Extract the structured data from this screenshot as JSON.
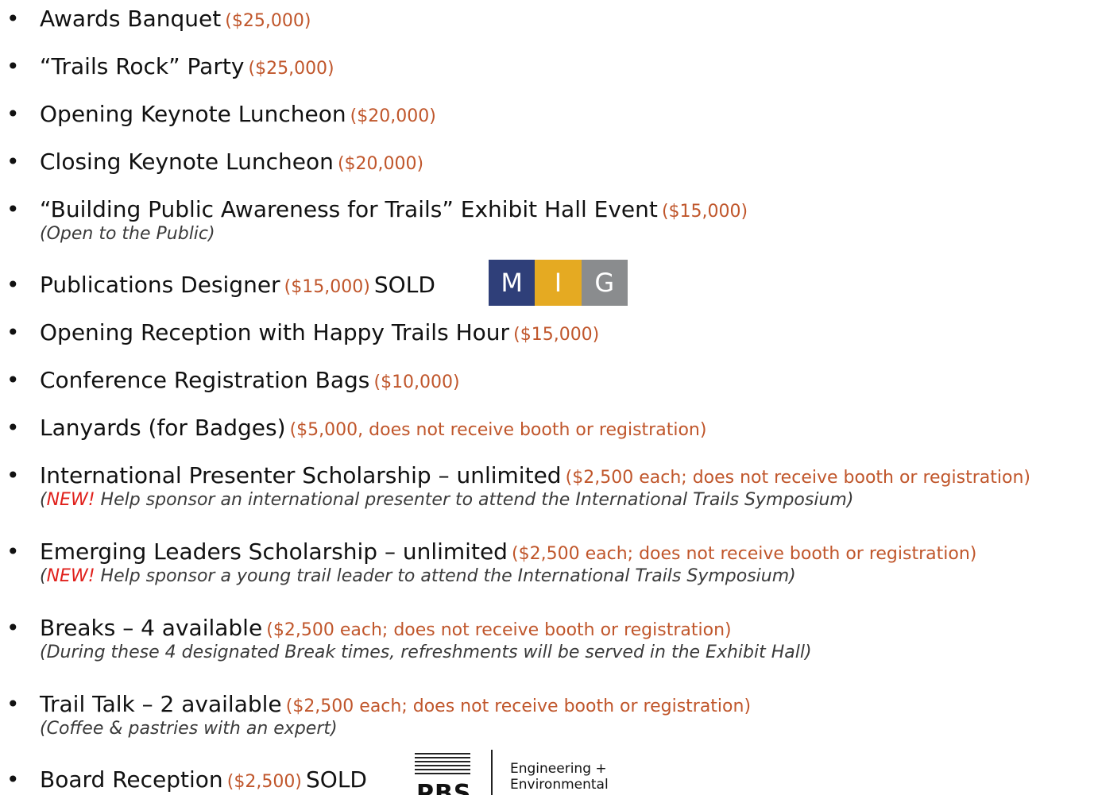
{
  "bullet_char": "•",
  "items": [
    {
      "label": "Awards Banquet",
      "price": "($25,000)"
    },
    {
      "label": "“Trails Rock” Party",
      "price": "($25,000)"
    },
    {
      "label": "Opening Keynote Luncheon",
      "price": "($20,000)"
    },
    {
      "label": "Closing Keynote Luncheon",
      "price": "($20,000)"
    },
    {
      "label": "“Building Public Awareness for Trails” Exhibit Hall Event",
      "price": "($15,000)",
      "note": "(Open to the Public)"
    },
    {
      "label": "Publications Designer",
      "price": "($15,000)",
      "sold": "SOLD"
    },
    {
      "label": "Opening Reception with Happy Trails Hour",
      "price": "($15,000)"
    },
    {
      "label": "Conference Registration Bags",
      "price": "($10,000)"
    },
    {
      "label": "Lanyards (for Badges)",
      "price": "($5,000, does not receive booth or registration)"
    },
    {
      "label": "International Presenter Scholarship – unlimited",
      "price": "($2,500 each; does not receive booth or registration)",
      "note_open": "(",
      "note_new": "NEW!",
      "note_rest": " Help sponsor an international presenter to attend the International Trails Symposium)"
    },
    {
      "label": "Emerging Leaders Scholarship – unlimited",
      "price": "($2,500 each; does not receive booth or registration)",
      "note_open": "(",
      "note_new": "NEW!",
      "note_rest": " Help sponsor a young trail leader to attend the International Trails Symposium)"
    },
    {
      "label": "Breaks – 4 available",
      "price": "($2,500 each; does not receive booth or registration)",
      "note": "(During these 4 designated Break times, refreshments will be served in the Exhibit Hall)"
    },
    {
      "label": "Trail Talk – 2 available",
      "price": "($2,500 each; does not receive booth or registration)",
      "note": "(Coffee & pastries with an expert)"
    },
    {
      "label": "Board Reception",
      "price": "($2,500)",
      "sold": "SOLD"
    }
  ],
  "logos": {
    "mig": {
      "m": "M",
      "i": "I",
      "g": "G"
    },
    "pbs": {
      "letters": "PBS",
      "line1": "Engineering +",
      "line2": "Environmental"
    }
  },
  "colors": {
    "price": "#c0562b",
    "new": "#e0201b",
    "mig_blue": "#2f3f79",
    "mig_gold": "#e5aa22",
    "mig_gray": "#8a8c8e"
  }
}
